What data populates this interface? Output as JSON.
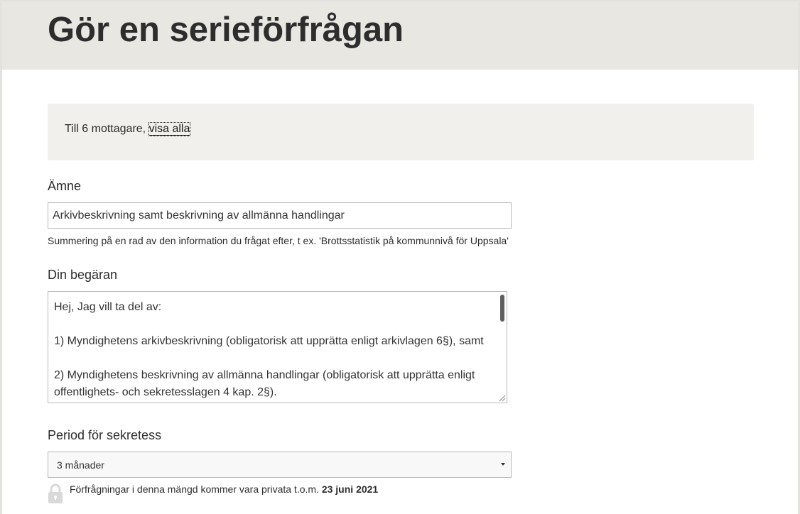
{
  "page": {
    "title": "Gör en serieförfrågan"
  },
  "recipients": {
    "text": "Till 6 mottagare,",
    "link": "visa alla"
  },
  "subject": {
    "label": "Ämne",
    "value": "Arkivbeskrivning samt beskrivning av allmänna handlingar",
    "help": "Summering på en rad av den information du frågat efter, t ex. 'Brottsstatistik på kommunnivå för Uppsala'"
  },
  "request": {
    "label": "Din begäran",
    "lines": [
      "Hej, Jag vill ta del av:",
      "1) Myndighetens arkivbeskrivning (obligatorisk att upprätta enligt arkivlagen 6§), samt",
      "2) Myndighetens beskrivning av allmänna handlingar (obligatorisk att upprätta enligt",
      "offentlighets- och sekretesslagen 4 kap. 2§)."
    ]
  },
  "privacy": {
    "label": "Period för sekretess",
    "selected": "3 månader",
    "note_prefix": "Förfrågningar i denna mängd kommer vara privata t.o.m.",
    "note_date": "23 juni 2021"
  },
  "icons": {
    "lock": "lock-icon",
    "caret": "caret-down-icon"
  },
  "colors": {
    "header_bg": "#e9e7e2",
    "panel_bg": "#f1f0ec",
    "text": "#2d2d2d",
    "border": "#b9b9b9"
  }
}
